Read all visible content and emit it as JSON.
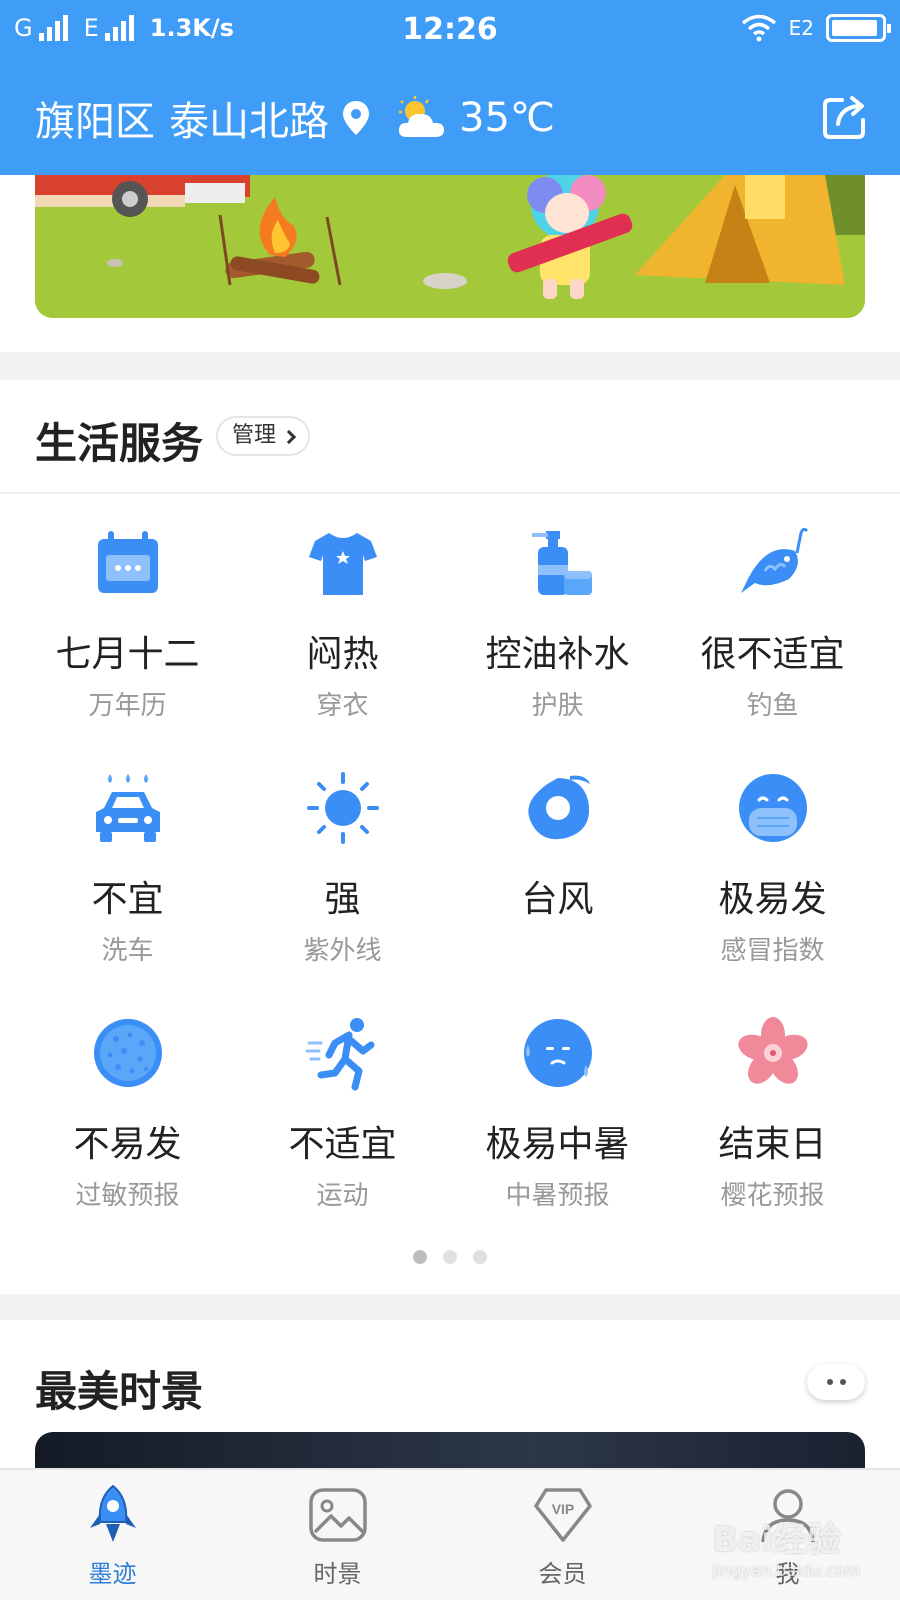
{
  "status_bar": {
    "carrier1": "G",
    "carrier2": "E",
    "speed": "1.3K/s",
    "time": "12:26",
    "network": "E2"
  },
  "header": {
    "district": "旗阳区",
    "road": "泰山北路",
    "temperature": "35℃",
    "weather_icon": "partly-cloudy-icon"
  },
  "services": {
    "title": "生活服务",
    "manage_label": "管理",
    "items": [
      {
        "main": "七月十二",
        "sub": "万年历",
        "icon": "calendar-icon"
      },
      {
        "main": "闷热",
        "sub": "穿衣",
        "icon": "tshirt-icon"
      },
      {
        "main": "控油补水",
        "sub": "护肤",
        "icon": "skincare-icon"
      },
      {
        "main": "很不适宜",
        "sub": "钓鱼",
        "icon": "fish-icon"
      },
      {
        "main": "不宜",
        "sub": "洗车",
        "icon": "car-wash-icon"
      },
      {
        "main": "强",
        "sub": "紫外线",
        "icon": "sun-icon"
      },
      {
        "main": "台风",
        "sub": "",
        "icon": "typhoon-icon"
      },
      {
        "main": "极易发",
        "sub": "感冒指数",
        "icon": "mask-icon"
      },
      {
        "main": "不易发",
        "sub": "过敏预报",
        "icon": "pollen-icon"
      },
      {
        "main": "不适宜",
        "sub": "运动",
        "icon": "runner-icon"
      },
      {
        "main": "极易中暑",
        "sub": "中暑预报",
        "icon": "heatstroke-face-icon"
      },
      {
        "main": "结束日",
        "sub": "樱花预报",
        "icon": "cherry-blossom-icon"
      }
    ],
    "page_count": 3,
    "active_page": 1
  },
  "scenery": {
    "title": "最美时景"
  },
  "tabbar": {
    "tabs": [
      {
        "label": "墨迹",
        "icon": "rocket-icon",
        "active": true
      },
      {
        "label": "时景",
        "icon": "picture-icon",
        "active": false
      },
      {
        "label": "会员",
        "icon": "vip-diamond-icon",
        "active": false
      },
      {
        "label": "我",
        "icon": "user-icon",
        "active": false
      }
    ]
  },
  "watermark": {
    "text": "Bai经验",
    "url_text": "jingyan.baidu.com"
  },
  "colors": {
    "primary": "#3f9cf7",
    "icon_blue": "#3a8ef6",
    "blossom_pink": "#f08a9a"
  }
}
